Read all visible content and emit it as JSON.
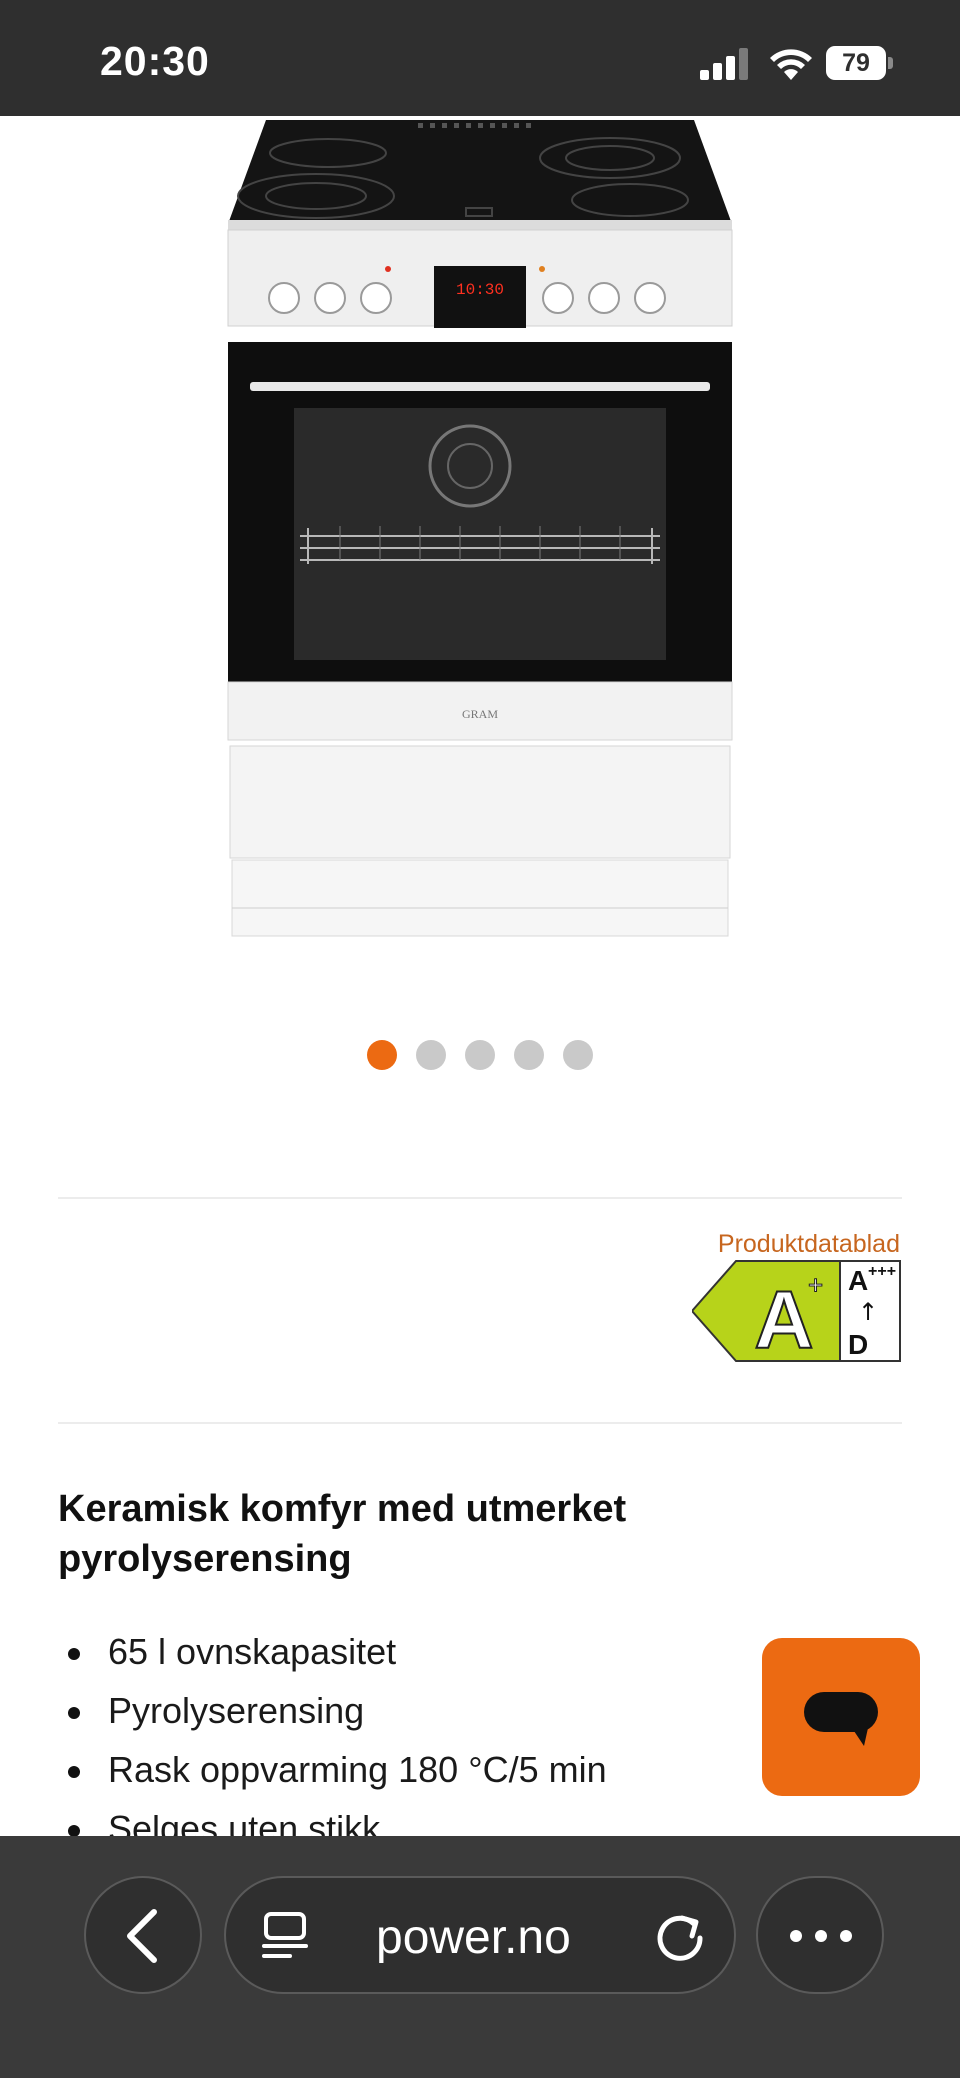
{
  "status_bar": {
    "time": "20:30",
    "battery": "79"
  },
  "carousel": {
    "total": 5,
    "active_index": 0
  },
  "energy": {
    "datasheet_link": "Produktdatablad",
    "class_letter": "A",
    "class_suffix": "+",
    "scale_top": "A",
    "scale_top_suffix": "+++",
    "scale_arrow": "↑",
    "scale_bottom": "D",
    "class_color": "#b7d31a"
  },
  "product": {
    "title": "Keramisk komfyr med utmerket pyrolyserensing",
    "features": [
      "65 l ovnskapasitet",
      "Pyrolyserensing",
      "Rask oppvarming 180 °C/5 min",
      "Selges uten stikk"
    ],
    "oven_display": "10:30",
    "brand": "GRAM"
  },
  "browser": {
    "url": "power.no"
  },
  "colors": {
    "accent": "#ec6a12",
    "link": "#c7661f"
  }
}
